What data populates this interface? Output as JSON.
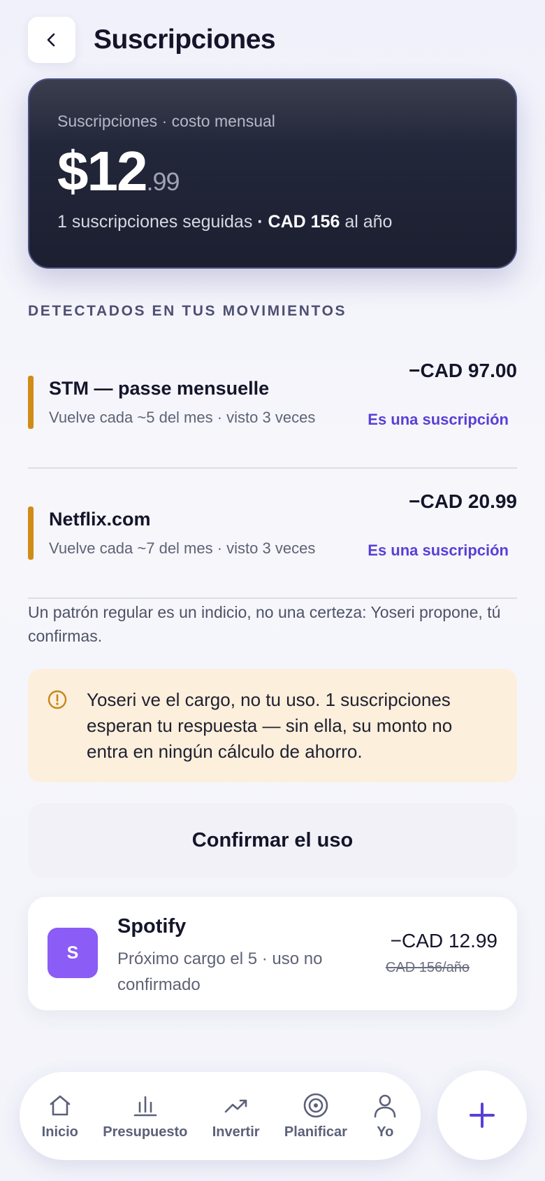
{
  "header": {
    "title": "Suscripciones",
    "back_icon": "chevron-left-icon"
  },
  "hero": {
    "label": "Suscripciones · costo mensual",
    "amount_main": "$12",
    "amount_cents": ".99",
    "count_text": "1 suscripciones seguidas",
    "separator": " · ",
    "annual_value": "CAD 156",
    "annual_suffix": " al año"
  },
  "detected": {
    "title": "DETECTADOS EN TUS MOVIMIENTOS",
    "items": [
      {
        "name": "STM — passe mensuelle",
        "meta": "Vuelve cada ~5 del mes · visto 3 veces",
        "amount": "−CAD 97.00",
        "action": "Es una suscripción"
      },
      {
        "name": "Netflix.com",
        "meta": "Vuelve cada ~7 del mes · visto 3 veces",
        "amount": "−CAD 20.99",
        "action": "Es una suscripción"
      }
    ]
  },
  "disclaimer": "Un patrón regular es un indicio, no una certeza: Yoseri propone, tú confirmas.",
  "warning": {
    "text": "Yoseri ve el cargo, no tu uso. 1 suscripciones esperan tu respuesta — sin ella, su monto no entra en ningún cálculo de ahorro.",
    "icon": "alert-circle-icon"
  },
  "confirm_button": "Confirmar el uso",
  "subscription": {
    "initial": "S",
    "name": "Spotify",
    "detail": "Próximo cargo el 5 · uso no confirmado",
    "amount": "−CAD 12.99",
    "annual": "CAD 156/año",
    "avatar_color": "#8b5cf6"
  },
  "nav": {
    "items": [
      {
        "label": "Inicio",
        "icon": "home-icon"
      },
      {
        "label": "Presupuesto",
        "icon": "bar-chart-icon"
      },
      {
        "label": "Invertir",
        "icon": "trending-up-icon"
      },
      {
        "label": "Planificar",
        "icon": "target-icon"
      },
      {
        "label": "Yo",
        "icon": "user-icon"
      }
    ],
    "fab_icon": "plus-icon"
  },
  "colors": {
    "accent": "#5a3fd6",
    "warning_bar": "#d18c17",
    "warning_bg": "#fcefdc",
    "hero_bg": "#1b1f30"
  }
}
